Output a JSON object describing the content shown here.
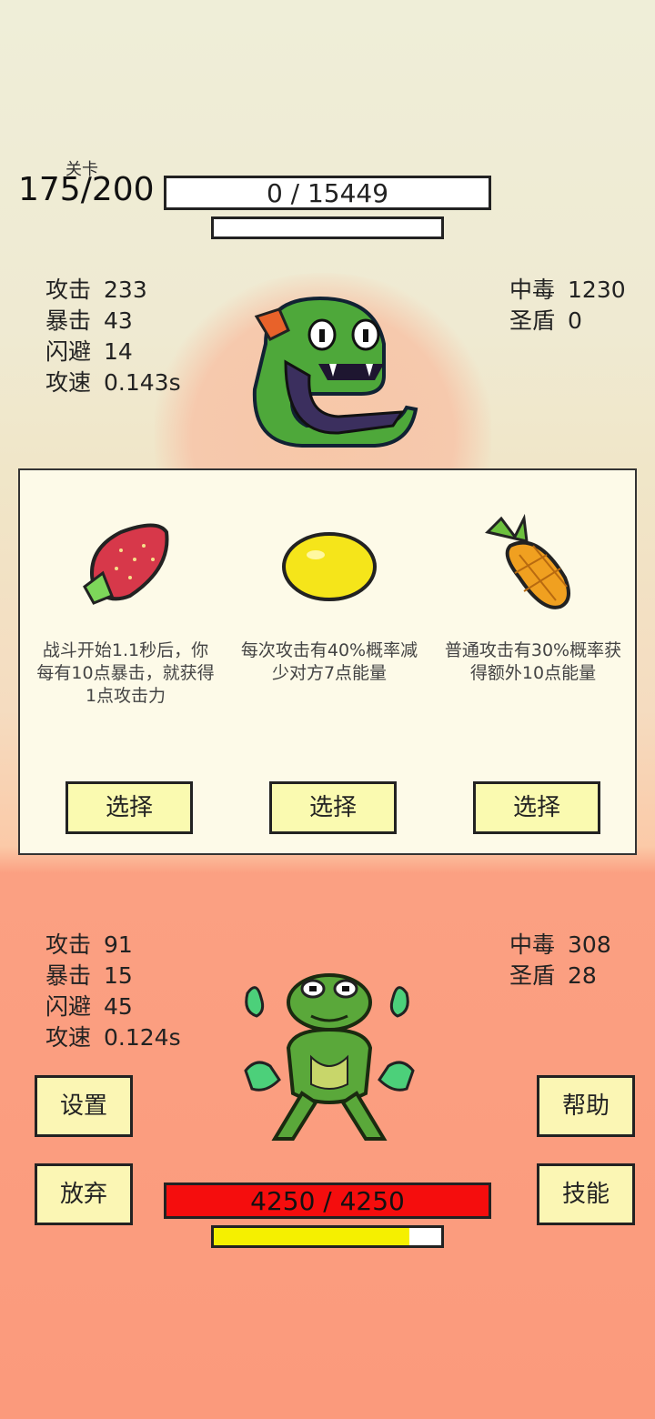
{
  "stage": {
    "label": "关卡",
    "value": "175/200"
  },
  "enemy": {
    "hp_text": "0 / 15449",
    "stats": [
      {
        "label": "攻击",
        "value": "233"
      },
      {
        "label": "暴击",
        "value": "43"
      },
      {
        "label": "闪避",
        "value": "14"
      },
      {
        "label": "攻速",
        "value": "0.143s"
      }
    ],
    "status": [
      {
        "label": "中毒",
        "value": "1230"
      },
      {
        "label": "圣盾",
        "value": "0"
      }
    ]
  },
  "choices": [
    {
      "icon": "strawberry-icon",
      "desc": "战斗开始1.1秒后，你每有10点暴击，就获得1点攻击力",
      "button": "选择"
    },
    {
      "icon": "lemon-icon",
      "desc": "每次攻击有40%概率减少对方7点能量",
      "button": "选择"
    },
    {
      "icon": "pineapple-icon",
      "desc": "普通攻击有30%概率获得额外10点能量",
      "button": "选择"
    }
  ],
  "player": {
    "hp_text": "4250 / 4250",
    "energy_fraction": 0.86,
    "stats": [
      {
        "label": "攻击",
        "value": "91"
      },
      {
        "label": "暴击",
        "value": "15"
      },
      {
        "label": "闪避",
        "value": "45"
      },
      {
        "label": "攻速",
        "value": "0.124s"
      }
    ],
    "status": [
      {
        "label": "中毒",
        "value": "308"
      },
      {
        "label": "圣盾",
        "value": "28"
      }
    ]
  },
  "buttons": {
    "settings": "设置",
    "help": "帮助",
    "quit": "放弃",
    "skills": "技能"
  },
  "colors": {
    "hp_red": "#f50d0d",
    "energy_yellow": "#f5f000",
    "button_bg": "#fbf6b4"
  }
}
